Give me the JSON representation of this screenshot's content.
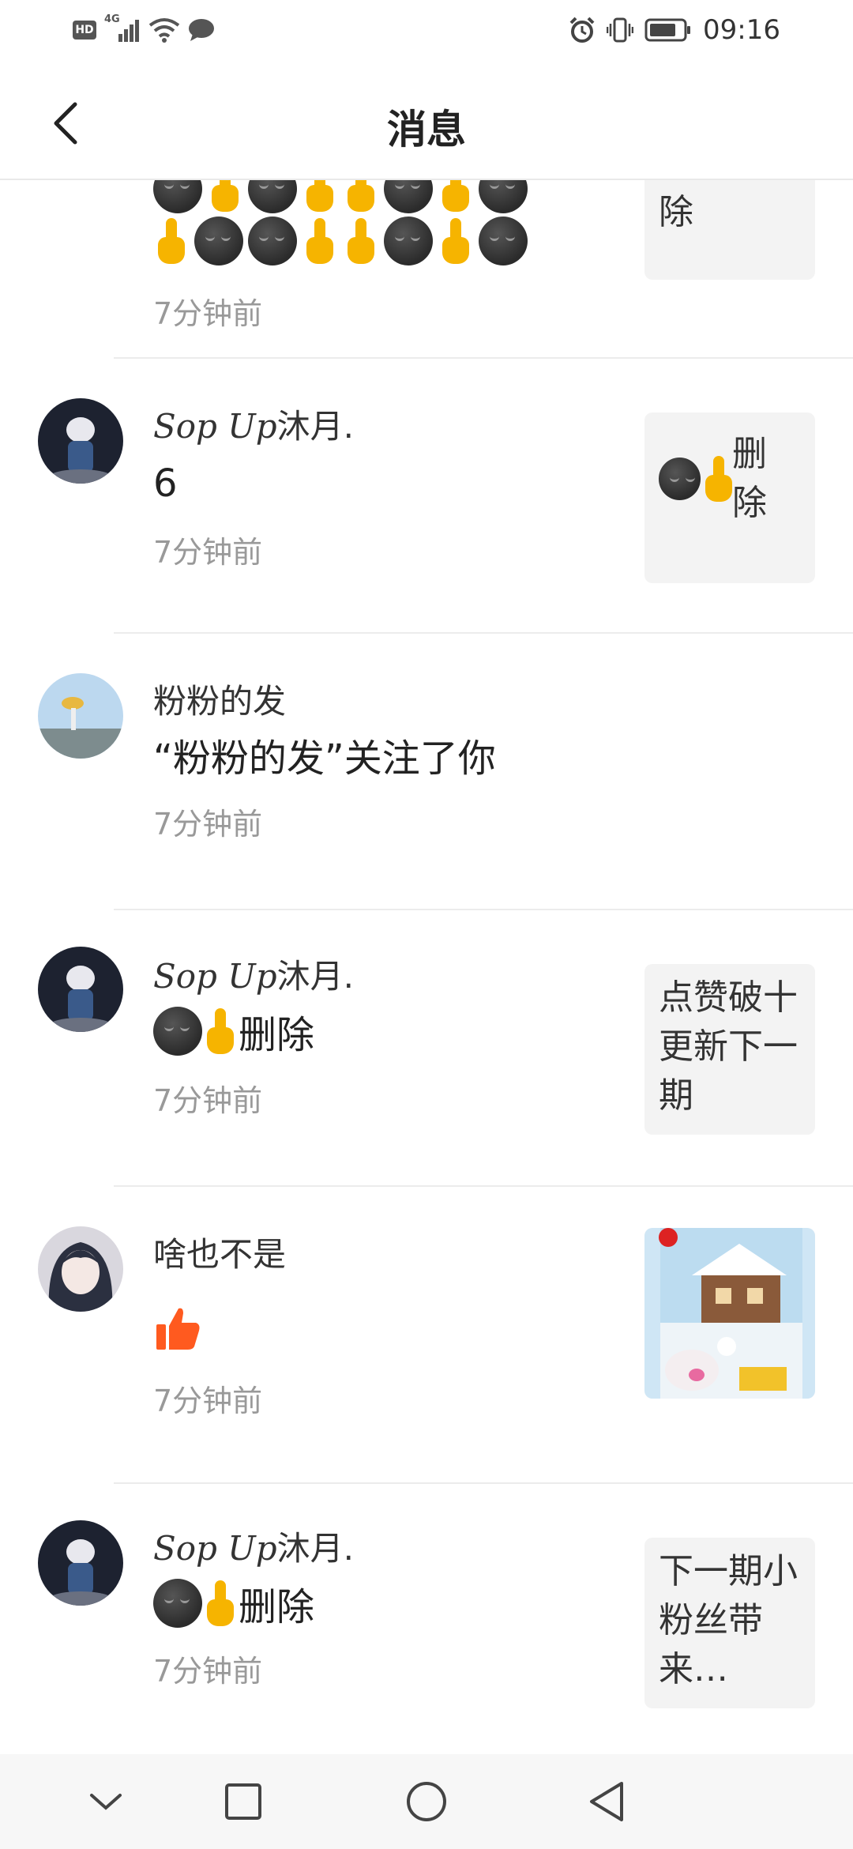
{
  "status_bar": {
    "hd_label": "HD",
    "network_label": "4G",
    "time": "09:16",
    "icons": [
      "hd-icon",
      "signal-icon",
      "wifi-icon",
      "chat-bubble-icon",
      "alarm-icon",
      "vibrate-icon",
      "battery-icon"
    ]
  },
  "header": {
    "title": "消息",
    "back_icon": "chevron-left-icon"
  },
  "messages": [
    {
      "name": "",
      "content_emoji": [
        "smirk",
        "finger",
        "smirk",
        "finger",
        "finger",
        "smirk",
        "finger",
        "smirk",
        "finger",
        "smirk",
        "smirk",
        "finger",
        "finger",
        "smirk",
        "finger",
        "smirk"
      ],
      "time": "7分钟前",
      "side_text": "除"
    },
    {
      "name_script": "Sop Up",
      "name_rest": "沐月.",
      "content": "6",
      "time": "7分钟前",
      "side_text": "删除"
    },
    {
      "name": "粉粉的发",
      "content": "“粉粉的发”关注了你",
      "time": "7分钟前"
    },
    {
      "name_script": "Sop Up",
      "name_rest": "沐月.",
      "content": "删除",
      "time": "7分钟前",
      "side_text": "点赞破十更新下一期"
    },
    {
      "name": "啥也不是",
      "content_icon": "thumbs-up-icon",
      "time": "7分钟前",
      "side_image": "game-screenshot-thumbnail"
    },
    {
      "name_script": "Sop Up",
      "name_rest": "沐月.",
      "content": "删除",
      "time": "7分钟前",
      "side_text": "下一期小粉丝带来…"
    }
  ],
  "nav_bar": {
    "icons": [
      "collapse-down-icon",
      "recent-apps-icon",
      "home-icon",
      "back-triangle-icon"
    ]
  },
  "colors": {
    "accent_like": "#ff5a1f",
    "time_gray": "#999999",
    "card_bg": "#f3f3f3"
  }
}
